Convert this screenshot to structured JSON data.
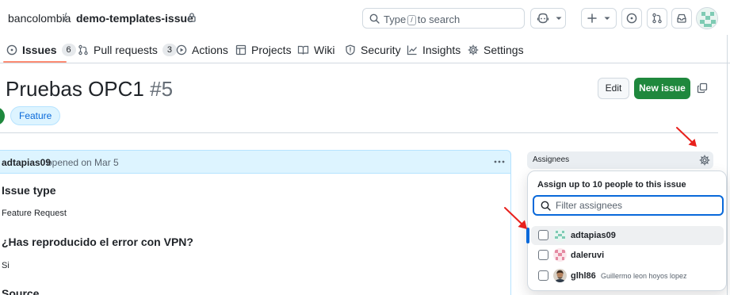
{
  "header": {
    "owner": "bancolombia",
    "separator": "/",
    "repo": "demo-templates-issue",
    "search_text_before": "Type",
    "search_key": "/",
    "search_text_after": "to search"
  },
  "tabs": [
    {
      "label": "Issues",
      "count": "6"
    },
    {
      "label": "Pull requests",
      "count": "3"
    },
    {
      "label": "Actions"
    },
    {
      "label": "Projects"
    },
    {
      "label": "Wiki"
    },
    {
      "label": "Security"
    },
    {
      "label": "Insights"
    },
    {
      "label": "Settings"
    }
  ],
  "issue": {
    "title": "Pruebas OPC1",
    "number": "#5",
    "edit_label": "Edit",
    "new_issue_label": "New issue",
    "label": "Feature"
  },
  "comment": {
    "author": "adtapias09",
    "meta": "opened on Mar 5",
    "heading_issue_type": "Issue type",
    "issue_type_value": "Feature Request",
    "heading_vpn": "¿Has reproducido el error con VPN?",
    "vpn_value": "Si",
    "heading_source": "Source"
  },
  "sidebar": {
    "assignees_title": "Assignees",
    "popover": {
      "title": "Assign up to 10 people to this issue",
      "filter_placeholder": "Filter assignees",
      "users": [
        {
          "login": "adtapias09",
          "name": ""
        },
        {
          "login": "daleruvi",
          "name": ""
        },
        {
          "login": "glhl86",
          "name": "Guillermo leon hoyos lopez"
        }
      ]
    }
  },
  "colors": {
    "accent": "#0969da",
    "primary_button": "#1f883d",
    "annotation_arrow": "#e8201c",
    "tab_underline": "#fd8c73"
  }
}
